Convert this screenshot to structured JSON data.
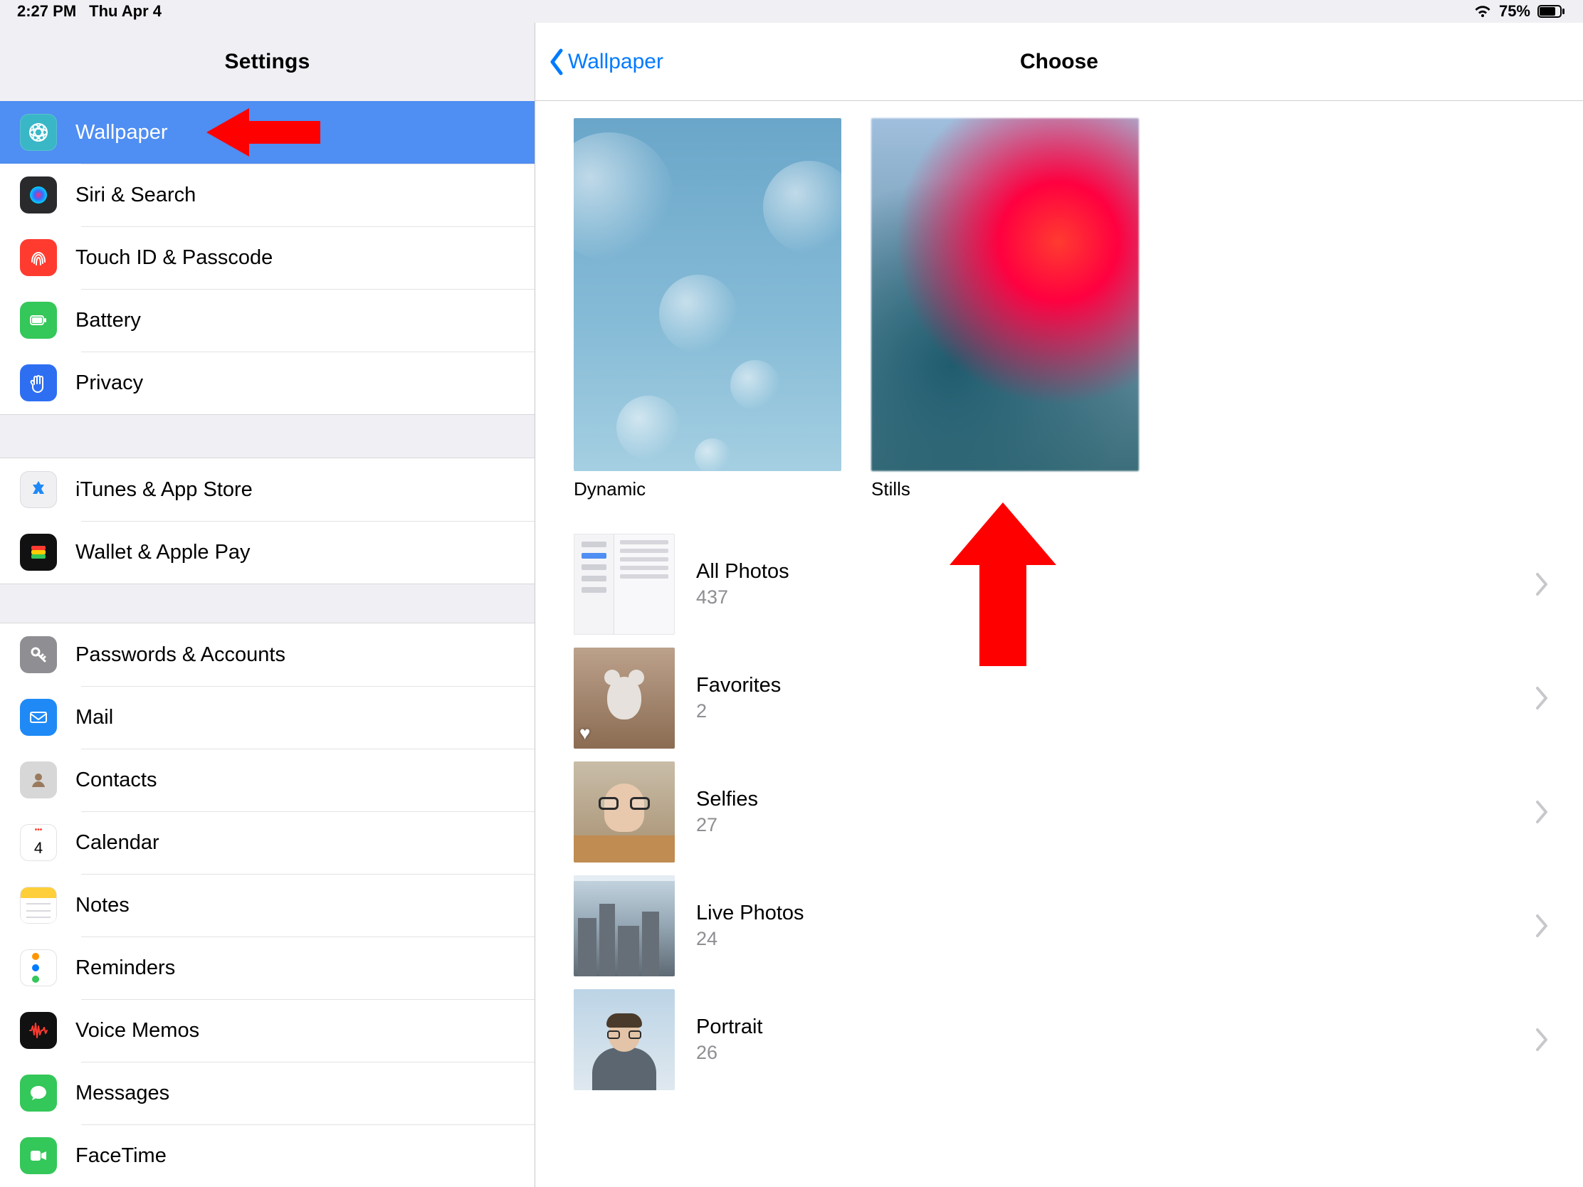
{
  "status": {
    "time": "2:27 PM",
    "date": "Thu Apr 4",
    "battery": "75%"
  },
  "sidebar": {
    "title": "Settings",
    "groups": [
      [
        {
          "label": "Wallpaper",
          "selected": true
        },
        {
          "label": "Siri & Search"
        },
        {
          "label": "Touch ID & Passcode"
        },
        {
          "label": "Battery"
        },
        {
          "label": "Privacy"
        }
      ],
      [
        {
          "label": "iTunes & App Store"
        },
        {
          "label": "Wallet & Apple Pay"
        }
      ],
      [
        {
          "label": "Passwords & Accounts"
        },
        {
          "label": "Mail"
        },
        {
          "label": "Contacts"
        },
        {
          "label": "Calendar"
        },
        {
          "label": "Notes"
        },
        {
          "label": "Reminders"
        },
        {
          "label": "Voice Memos"
        },
        {
          "label": "Messages"
        },
        {
          "label": "FaceTime"
        }
      ]
    ]
  },
  "main": {
    "back": "Wallpaper",
    "title": "Choose",
    "tiles": [
      {
        "label": "Dynamic"
      },
      {
        "label": "Stills"
      }
    ],
    "albums": [
      {
        "title": "All Photos",
        "count": "437"
      },
      {
        "title": "Favorites",
        "count": "2"
      },
      {
        "title": "Selfies",
        "count": "27"
      },
      {
        "title": "Live Photos",
        "count": "24"
      },
      {
        "title": "Portrait",
        "count": "26"
      }
    ]
  }
}
